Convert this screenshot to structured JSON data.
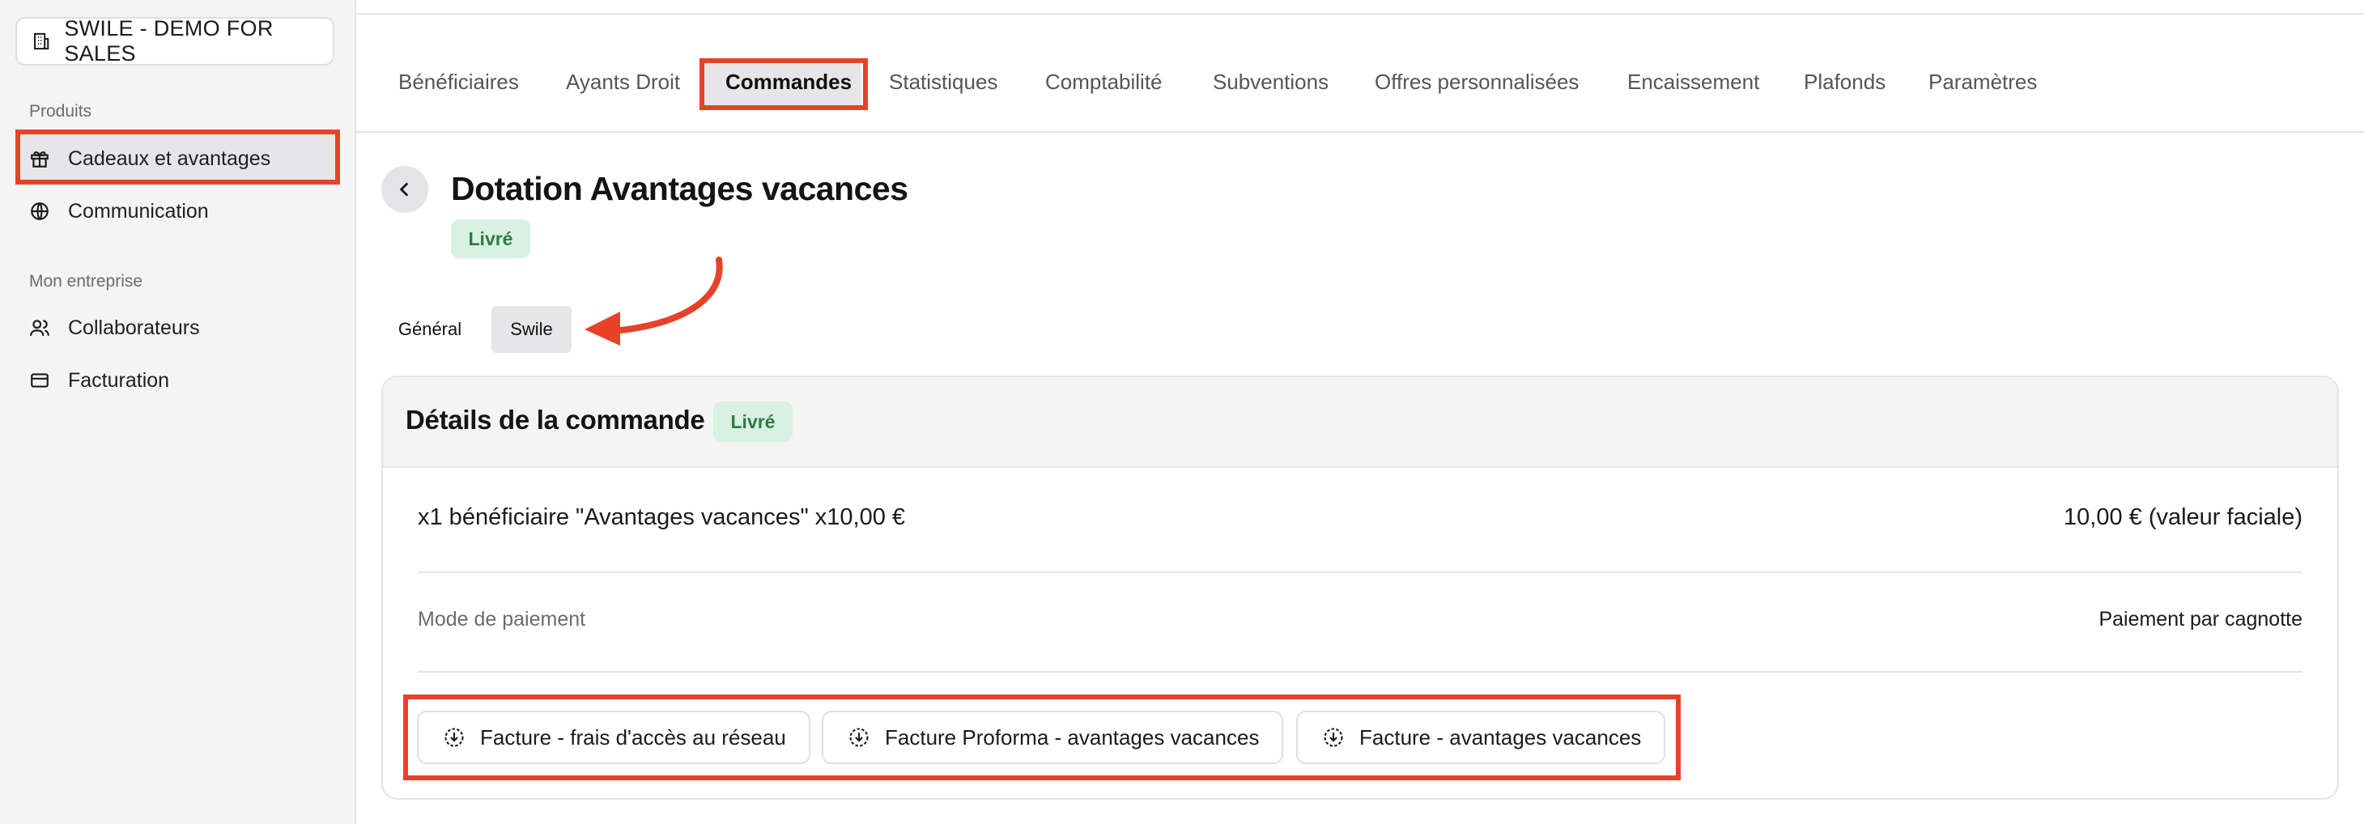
{
  "sidebar": {
    "org_name": "SWILE - DEMO FOR SALES",
    "section_products": "Produits",
    "section_company": "Mon entreprise",
    "items": [
      {
        "label": "Cadeaux et avantages",
        "icon": "gift-icon",
        "active": true
      },
      {
        "label": "Communication",
        "icon": "globe-icon",
        "active": false
      },
      {
        "label": "Collaborateurs",
        "icon": "users-icon",
        "active": false
      },
      {
        "label": "Facturation",
        "icon": "credit-card-icon",
        "active": false
      }
    ]
  },
  "tabs": [
    {
      "label": "Bénéficiaires",
      "active": false
    },
    {
      "label": "Ayants Droit",
      "active": false
    },
    {
      "label": "Commandes",
      "active": true
    },
    {
      "label": "Statistiques",
      "active": false
    },
    {
      "label": "Comptabilité",
      "active": false
    },
    {
      "label": "Subventions",
      "active": false
    },
    {
      "label": "Offres personnalisées",
      "active": false
    },
    {
      "label": "Encaissement",
      "active": false
    },
    {
      "label": "Plafonds",
      "active": false
    },
    {
      "label": "Paramètres",
      "active": false
    }
  ],
  "header": {
    "title": "Dotation Avantages vacances",
    "status": "Livré"
  },
  "subtabs": [
    {
      "label": "Général",
      "active": false
    },
    {
      "label": "Swile",
      "active": true
    }
  ],
  "order": {
    "title": "Détails de la commande",
    "status": "Livré",
    "line_item": "x1 bénéficiaire \"Avantages vacances\" x10,00 €",
    "line_value": "10,00 € (valeur faciale)",
    "payment_label": "Mode de paiement",
    "payment_value": "Paiement par cagnotte",
    "downloads": [
      "Facture - frais d'accès au réseau",
      "Facture Proforma - avantages vacances",
      "Facture - avantages vacances"
    ]
  },
  "colors": {
    "highlight": "#e8412a",
    "badge_bg": "#d9f1e1",
    "badge_text": "#2e7a48",
    "sidebar_bg": "#f4f4f5"
  }
}
